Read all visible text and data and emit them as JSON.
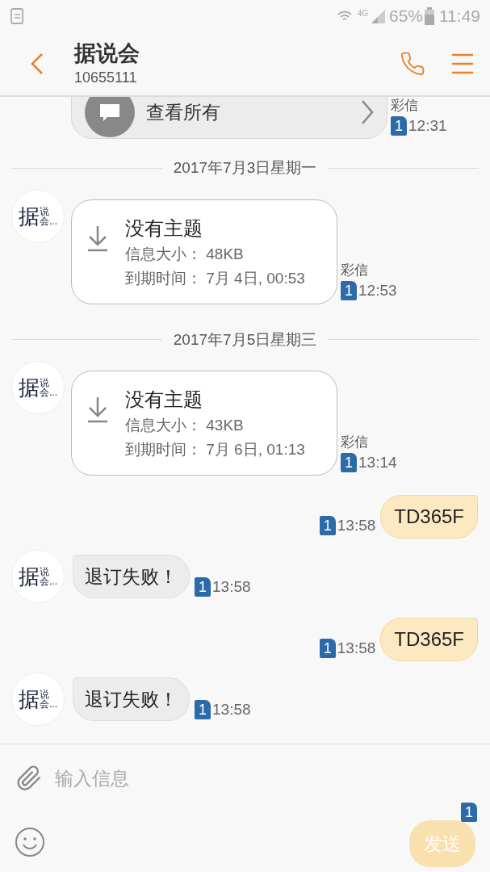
{
  "status_bar": {
    "network": "4G",
    "battery": "65%",
    "time": "11:49"
  },
  "header": {
    "title": "据说会",
    "subtitle": "10655111"
  },
  "messages": [
    {
      "kind": "view_all",
      "label": "查看所有",
      "type_label": "彩信",
      "sim": "1",
      "time": "12:31"
    },
    {
      "kind": "date",
      "text": "2017年7月3日星期一"
    },
    {
      "kind": "mms",
      "avatar": {
        "main": "据",
        "top": "说",
        "bottom": "会..."
      },
      "subject": "没有主题",
      "size": "信息大小： 48KB",
      "expiry": "到期时间： 7月 4日, 00:53",
      "type_label": "彩信",
      "sim": "1",
      "time": "12:53"
    },
    {
      "kind": "date",
      "text": "2017年7月5日星期三"
    },
    {
      "kind": "mms",
      "avatar": {
        "main": "据",
        "top": "说",
        "bottom": "会..."
      },
      "subject": "没有主题",
      "size": "信息大小： 43KB",
      "expiry": "到期时间： 7月 6日, 01:13",
      "type_label": "彩信",
      "sim": "1",
      "time": "13:14"
    },
    {
      "kind": "outgoing",
      "text": "TD365F",
      "sim": "1",
      "time": "13:58"
    },
    {
      "kind": "incoming",
      "avatar": {
        "main": "据",
        "top": "说",
        "bottom": "会..."
      },
      "text": "退订失败！",
      "sim": "1",
      "time": "13:58"
    },
    {
      "kind": "outgoing",
      "text": "TD365F",
      "sim": "1",
      "time": "13:58"
    },
    {
      "kind": "incoming",
      "avatar": {
        "main": "据",
        "top": "说",
        "bottom": "会..."
      },
      "text": "退订失败！",
      "sim": "1",
      "time": "13:58"
    }
  ],
  "composer": {
    "placeholder": "输入信息",
    "send": {
      "label": "发送",
      "sim": "1",
      "disabled": true
    }
  }
}
